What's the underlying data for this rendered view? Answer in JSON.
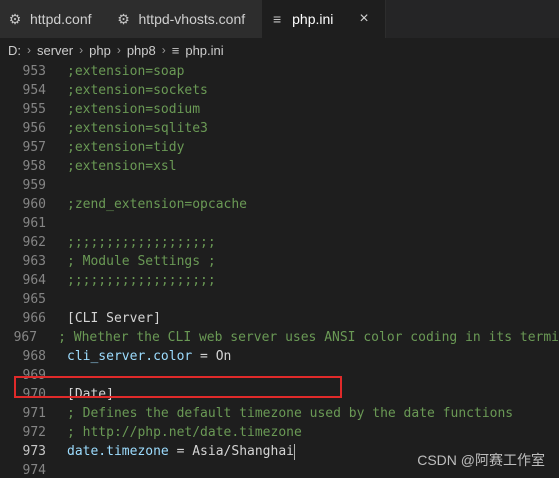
{
  "tabs": [
    {
      "label": "httpd.conf",
      "icon": "gear-icon",
      "active": false
    },
    {
      "label": "httpd-vhosts.conf",
      "icon": "gear-icon",
      "active": false
    },
    {
      "label": "php.ini",
      "icon": "lines-icon",
      "active": true,
      "close": "×"
    }
  ],
  "breadcrumb": [
    "D:",
    "server",
    "php",
    "php8",
    "php.ini"
  ],
  "lines": [
    {
      "n": "953",
      "t": ";extension=soap"
    },
    {
      "n": "954",
      "t": ";extension=sockets"
    },
    {
      "n": "955",
      "t": ";extension=sodium"
    },
    {
      "n": "956",
      "t": ";extension=sqlite3"
    },
    {
      "n": "957",
      "t": ";extension=tidy"
    },
    {
      "n": "958",
      "t": ";extension=xsl"
    },
    {
      "n": "959",
      "t": ""
    },
    {
      "n": "960",
      "t": ";zend_extension=opcache"
    },
    {
      "n": "961",
      "t": ""
    },
    {
      "n": "962",
      "t": ";;;;;;;;;;;;;;;;;;;"
    },
    {
      "n": "963",
      "t": "; Module Settings ;"
    },
    {
      "n": "964",
      "t": ";;;;;;;;;;;;;;;;;;;"
    },
    {
      "n": "965",
      "t": ""
    },
    {
      "n": "966",
      "t": "[CLI Server]"
    },
    {
      "n": "967",
      "t": "; Whether the CLI web server uses ANSI color coding in its termi"
    },
    {
      "n": "968",
      "key": "cli_server.color",
      "val": "On"
    },
    {
      "n": "969",
      "t": ""
    },
    {
      "n": "970",
      "t": "[Date]"
    },
    {
      "n": "971",
      "t": "; Defines the default timezone used by the date functions"
    },
    {
      "n": "972",
      "t": "; http://php.net/date.timezone"
    },
    {
      "n": "973",
      "key": "date.timezone",
      "val": "Asia/Shanghai",
      "current": true
    },
    {
      "n": "974",
      "t": ""
    }
  ],
  "watermark": "CSDN @阿赛工作室",
  "colors": {
    "highlight_border": "#e02a2a",
    "comment": "#6a9955",
    "key": "#9cdcfe"
  }
}
